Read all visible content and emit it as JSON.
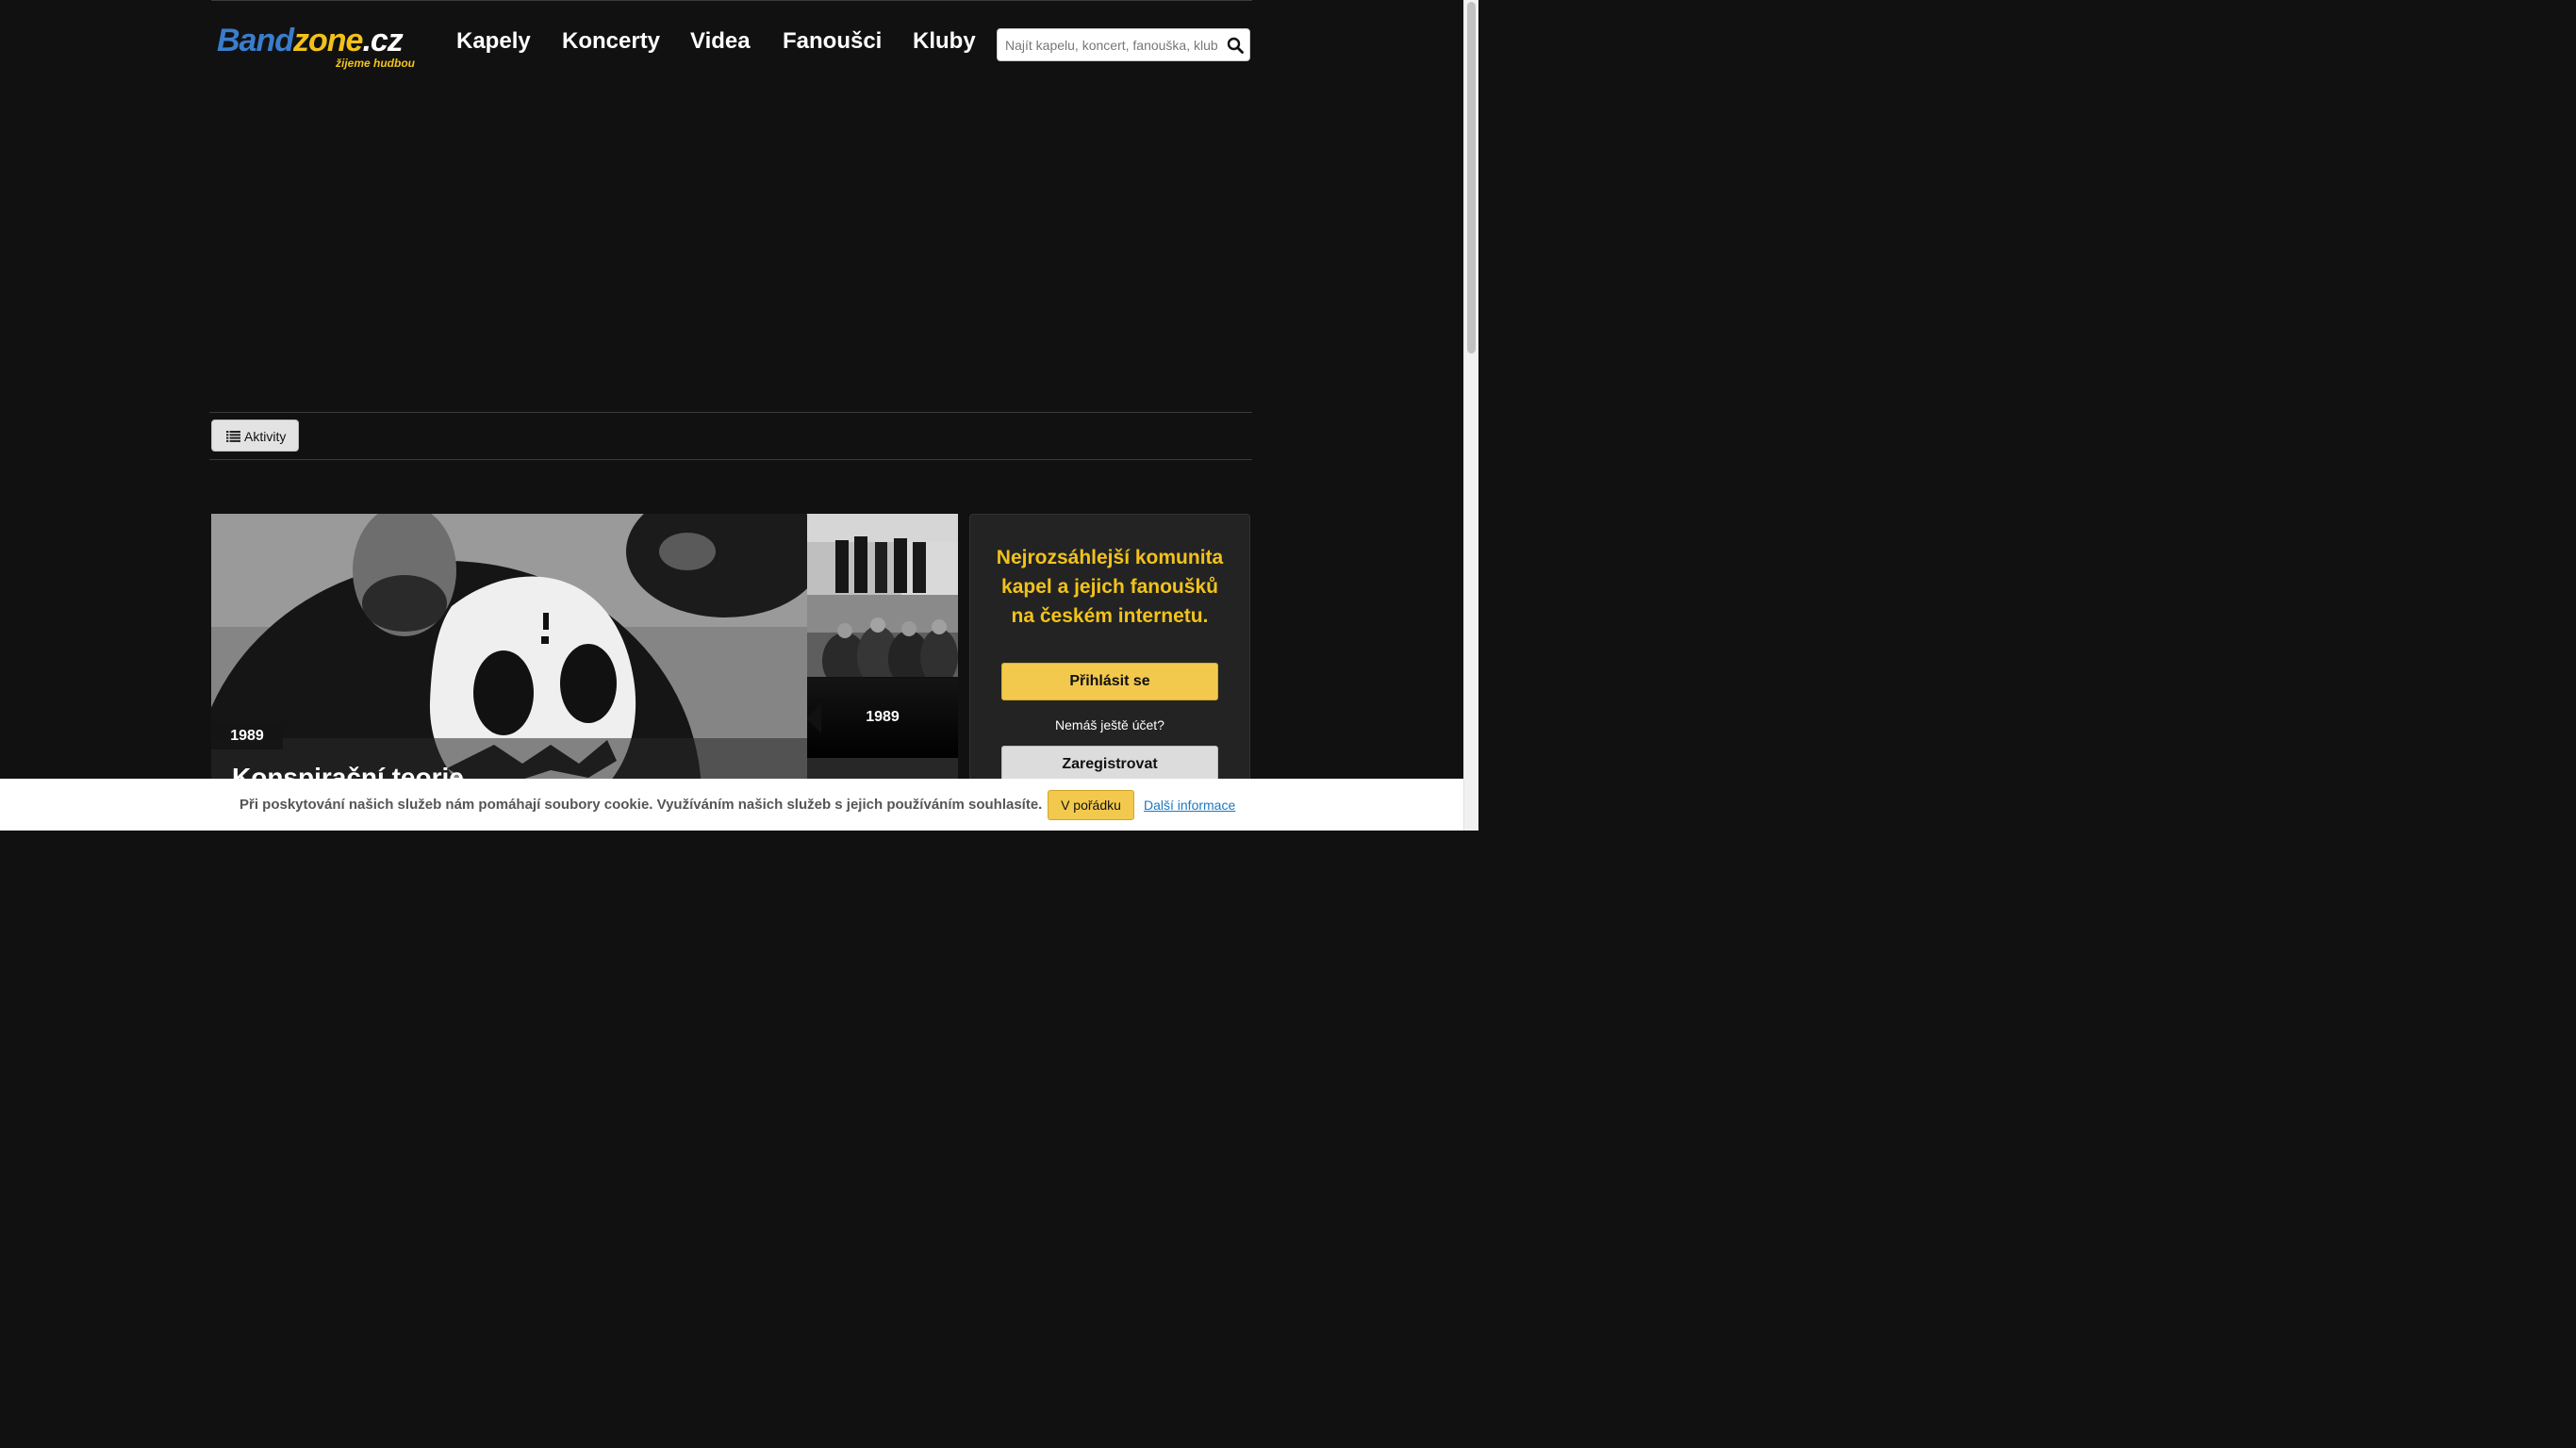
{
  "header": {
    "logo": {
      "word_band": "Band",
      "word_zone": "zone",
      "word_cz": ".cz",
      "tagline": "žijeme hudbou"
    },
    "nav": [
      {
        "label": "Kapely"
      },
      {
        "label": "Koncerty"
      },
      {
        "label": "Videa"
      },
      {
        "label": "Fanoušci"
      },
      {
        "label": "Kluby"
      }
    ],
    "search": {
      "placeholder": "Najít kapelu, koncert, fanouška, klub",
      "icon": "search-icon"
    }
  },
  "toolbar": {
    "activity_label": "Aktivity",
    "icon": "list-icon"
  },
  "hero": {
    "year": "1989",
    "title": "Konspirační teorie",
    "thumbs": [
      {
        "year": "1989"
      }
    ]
  },
  "sidebar": {
    "headline": "Nejrozsáhlejší komunita kapel a jejich fanoušků na českém internetu.",
    "login_label": "Přihlásit se",
    "no_account_text": "Nemáš ještě účet?",
    "register_label": "Zaregistrovat"
  },
  "cookie": {
    "message": "Při poskytování našich služeb nám pomáhají soubory cookie. Využíváním našich služeb s jejich používáním souhlasíte.",
    "accept_label": "V pořádku",
    "more_label": "Další informace"
  },
  "colors": {
    "background": "#111111",
    "accent_yellow": "#f2c94c",
    "logo_blue": "#3a7dcc",
    "link_blue": "#1a78c2"
  }
}
